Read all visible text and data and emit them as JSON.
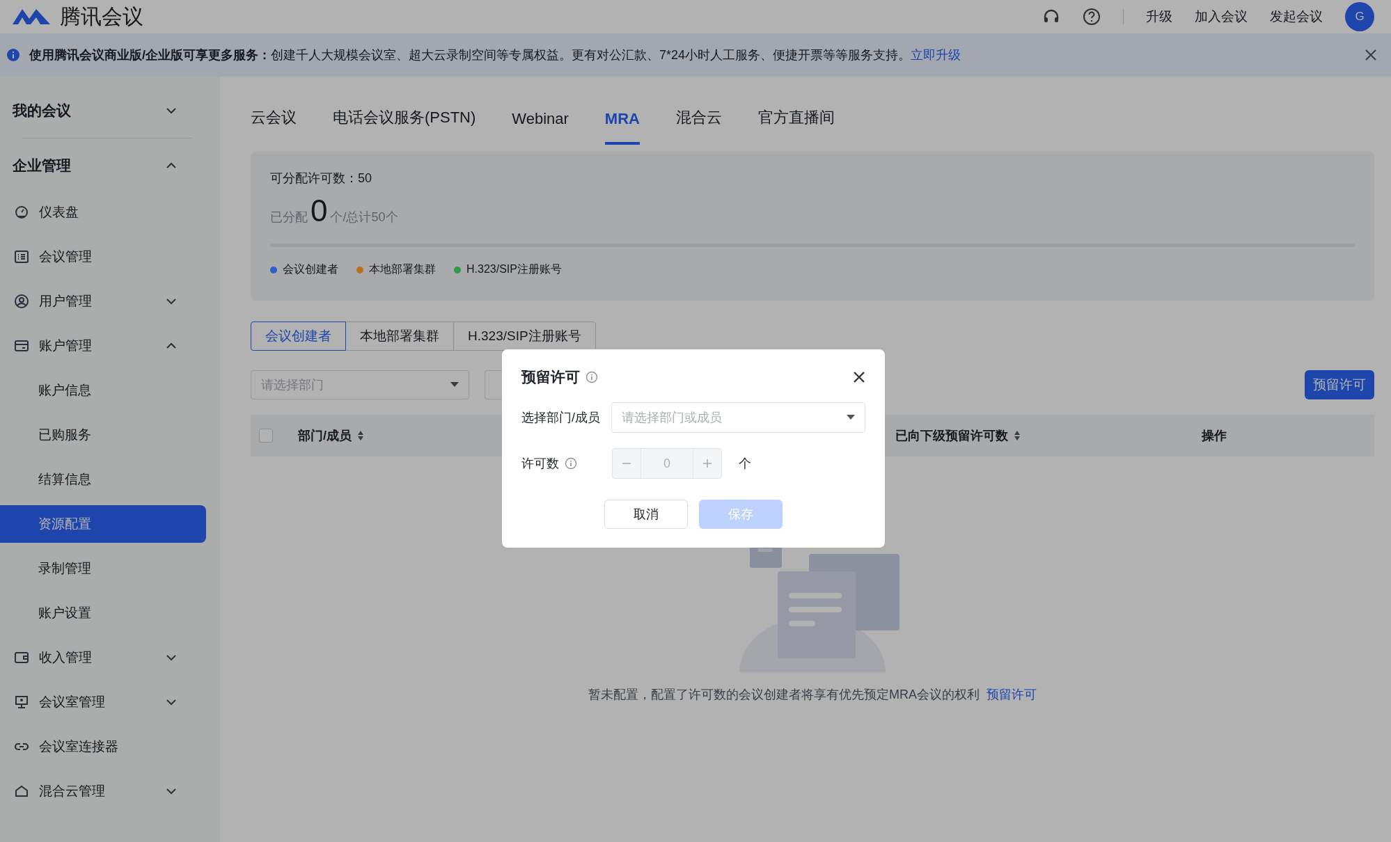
{
  "app": {
    "name": "腾讯会议"
  },
  "top_nav": {
    "links": [
      "升级",
      "加入会议",
      "发起会议"
    ],
    "avatar": "G"
  },
  "banner": {
    "lead": "使用腾讯会议商业版/企业版可享更多服务：",
    "text": "创建千人大规模会议室、超大云录制空间等专属权益。更有对公汇款、7*24小时人工服务、便捷开票等等服务支持。",
    "link": "立即升级"
  },
  "sidebar": {
    "items": [
      {
        "label": "我的会议",
        "kind": "section",
        "expanded": false,
        "selected": false
      },
      {
        "label": "企业管理",
        "kind": "section",
        "expanded": true,
        "selected": false,
        "children": [
          {
            "label": "仪表盘",
            "kind": "item",
            "selected": false
          },
          {
            "label": "会议管理",
            "kind": "item",
            "selected": false
          },
          {
            "label": "用户管理",
            "kind": "item",
            "expanded": false,
            "selected": false
          },
          {
            "label": "账户管理",
            "kind": "item",
            "expanded": true,
            "selected": false,
            "children": [
              {
                "label": "账户信息",
                "kind": "subitem",
                "selected": false
              },
              {
                "label": "已购服务",
                "kind": "subitem",
                "selected": false
              },
              {
                "label": "结算信息",
                "kind": "subitem",
                "selected": false
              },
              {
                "label": "资源配置",
                "kind": "subitem",
                "selected": true
              },
              {
                "label": "录制管理",
                "kind": "subitem",
                "selected": false
              },
              {
                "label": "账户设置",
                "kind": "subitem",
                "selected": false
              }
            ]
          },
          {
            "label": "收入管理",
            "kind": "item",
            "expanded": false,
            "selected": false
          },
          {
            "label": "会议室管理",
            "kind": "item",
            "expanded": false,
            "selected": false
          },
          {
            "label": "会议室连接器",
            "kind": "item",
            "selected": false
          },
          {
            "label": "混合云管理",
            "kind": "item",
            "expanded": false,
            "selected": false
          }
        ]
      }
    ]
  },
  "tabs": [
    {
      "label": "云会议",
      "selected": false
    },
    {
      "label": "电话会议服务(PSTN)",
      "selected": false
    },
    {
      "label": "Webinar",
      "selected": false
    },
    {
      "label": "MRA",
      "selected": true
    },
    {
      "label": "混合云",
      "selected": false
    },
    {
      "label": "官方直播间",
      "selected": false
    }
  ],
  "stats": {
    "available": "可分配许可数：50",
    "allocated_label": "已分配",
    "allocated_count": "0",
    "total": "个/总计50个",
    "level": 0,
    "legend": [
      {
        "label": "会议创建者",
        "color": "#2f5fc8"
      },
      {
        "label": "本地部署集群",
        "color": "#b8701f"
      },
      {
        "label": "H.323/SIP注册账号",
        "color": "#2e9a46"
      }
    ]
  },
  "sub_tabs": [
    {
      "label": "会议创建者",
      "selected": true
    },
    {
      "label": "本地部署集群",
      "selected": false
    },
    {
      "label": "H.323/SIP注册账号",
      "selected": false
    }
  ],
  "filter": {
    "placeholder": "请选择部门"
  },
  "reserve_button": "预留许可",
  "table": {
    "select_all": {
      "checked": false
    },
    "columns": [
      {
        "label": "部门/成员",
        "sortable": true
      },
      {
        "label": "已向下级预留许可数",
        "sortable": true
      },
      {
        "label": "操作",
        "sortable": false
      }
    ]
  },
  "empty": {
    "text": "暂未配置，配置了许可数的会议创建者将享有优先预定MRA会议的权利",
    "link": "预留许可"
  },
  "dialog": {
    "title": "预留许可",
    "member_label": "选择部门/成员",
    "member_placeholder": "请选择部门或成员",
    "count_label": "许可数",
    "count_value": "0",
    "unit": "个",
    "buttons": [
      {
        "label": "取消",
        "kind": "secondary",
        "disabled": false
      },
      {
        "label": "保存",
        "kind": "primary",
        "disabled": true
      }
    ]
  }
}
